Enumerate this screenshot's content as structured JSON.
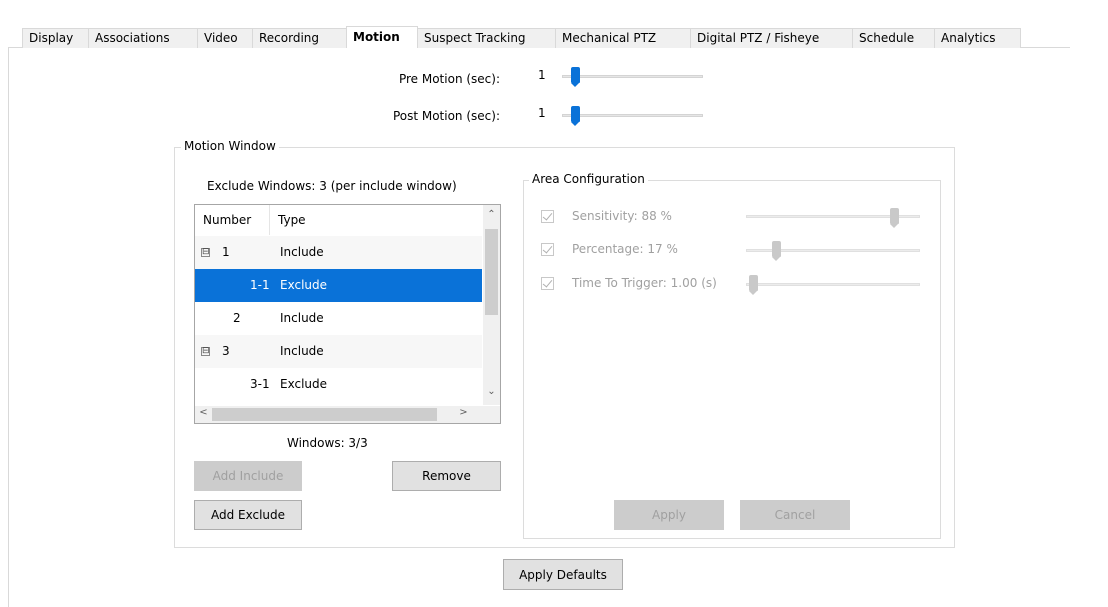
{
  "tabs": [
    {
      "label": "Display",
      "active": false
    },
    {
      "label": "Associations",
      "active": false
    },
    {
      "label": "Video",
      "active": false
    },
    {
      "label": "Recording",
      "active": false
    },
    {
      "label": "Motion",
      "active": true
    },
    {
      "label": "Suspect Tracking",
      "active": false
    },
    {
      "label": "Mechanical PTZ",
      "active": false
    },
    {
      "label": "Digital PTZ / Fisheye",
      "active": false
    },
    {
      "label": "Schedule",
      "active": false
    },
    {
      "label": "Analytics",
      "active": false
    }
  ],
  "pre_motion": {
    "label": "Pre Motion (sec):",
    "value": "1"
  },
  "post_motion": {
    "label": "Post Motion (sec):",
    "value": "1"
  },
  "motion_window": {
    "title": "Motion Window",
    "exclude_caption": "Exclude Windows: 3 (per include window)",
    "columns": [
      "Number",
      "Type"
    ],
    "rows": [
      {
        "number": "1",
        "type": "Include",
        "expander": "⊟",
        "selected": false
      },
      {
        "number": "1-1",
        "type": "Exclude",
        "expander": "",
        "selected": true
      },
      {
        "number": "2",
        "type": "Include",
        "expander": "",
        "selected": false
      },
      {
        "number": "3",
        "type": "Include",
        "expander": "⊟",
        "selected": false
      },
      {
        "number": "3-1",
        "type": "Exclude",
        "expander": "",
        "selected": false
      }
    ],
    "windows_count": "Windows: 3/3",
    "add_include_label": "Add Include",
    "remove_label": "Remove",
    "add_exclude_label": "Add Exclude"
  },
  "area_configuration": {
    "title": "Area Configuration",
    "sensitivity_label": "Sensitivity: 88 %",
    "sensitivity_value": 88,
    "percentage_label": "Percentage: 17 %",
    "percentage_value": 17,
    "time_label": "Time To Trigger: 1.00 (s)",
    "apply_label": "Apply",
    "cancel_label": "Cancel"
  },
  "apply_defaults_label": "Apply Defaults",
  "colors": {
    "accent": "#0a72d8",
    "disabled": "#a0a0a0"
  }
}
